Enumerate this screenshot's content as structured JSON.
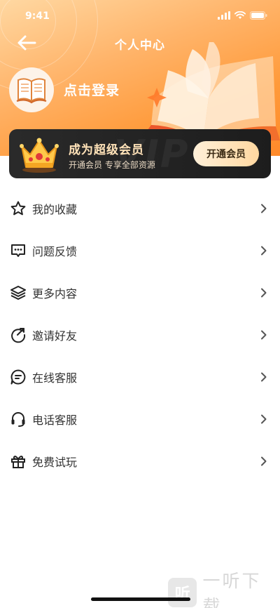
{
  "status_bar": {
    "time": "9:41"
  },
  "header": {
    "title": "个人中心"
  },
  "profile": {
    "login_label": "点击登录"
  },
  "vip": {
    "title": "成为超级会员",
    "subtitle": "开通会员 专享全部资源",
    "button_label": "开通会员",
    "watermark": "VIP"
  },
  "menu": [
    {
      "label": "我的收藏",
      "icon": "star-icon"
    },
    {
      "label": "问题反馈",
      "icon": "message-dots-icon"
    },
    {
      "label": "更多内容",
      "icon": "layers-icon"
    },
    {
      "label": "邀请好友",
      "icon": "share-arrow-icon"
    },
    {
      "label": "在线客服",
      "icon": "chat-lines-icon"
    },
    {
      "label": "电话客服",
      "icon": "headset-icon"
    },
    {
      "label": "免费试玩",
      "icon": "gift-icon"
    }
  ],
  "watermark": {
    "glyph": "听",
    "text": "一听下载"
  },
  "colors": {
    "accent": "#ff9a3a",
    "vip_gold": "#ffe2b8",
    "vip_card": "#1d1d1d",
    "text": "#333333"
  }
}
